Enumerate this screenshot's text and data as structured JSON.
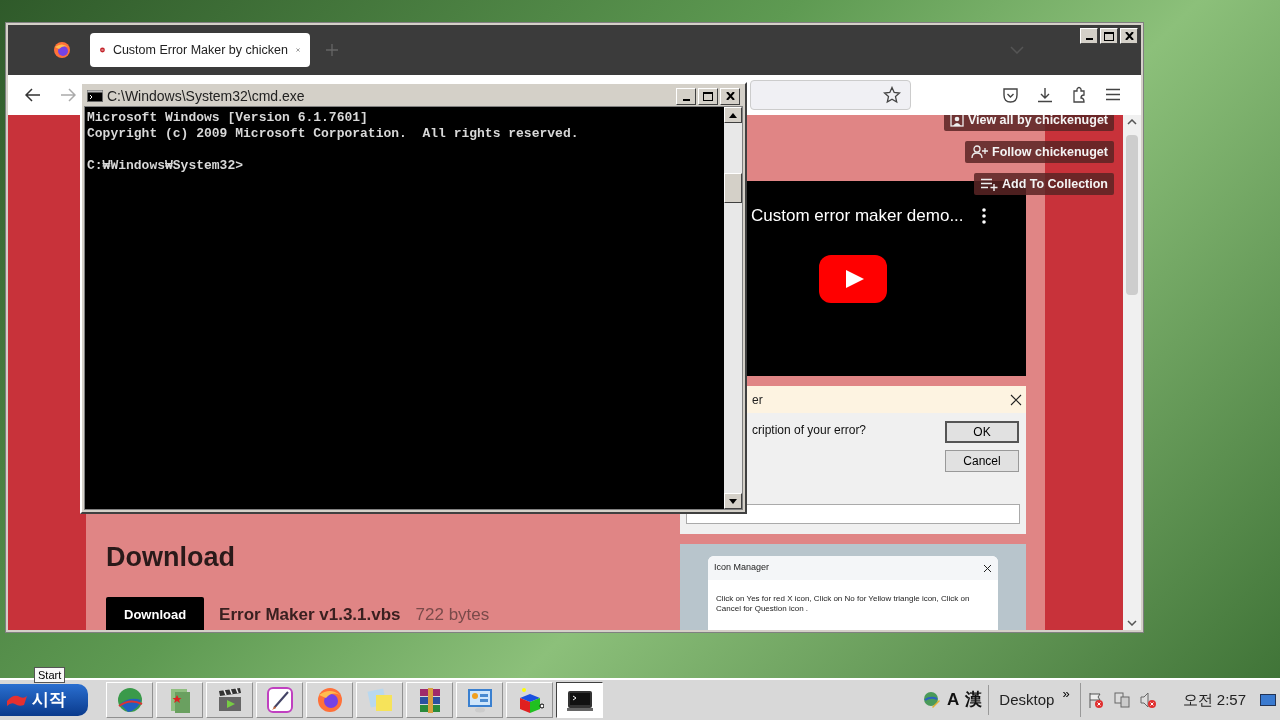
{
  "browser": {
    "tabs": [
      {
        "title": "Custom Error Maker by chicken",
        "selected": true
      }
    ],
    "page": {
      "actions": [
        {
          "kind": "view",
          "label": "View all by chickenuget"
        },
        {
          "kind": "follow",
          "label": "Follow chickenuget"
        },
        {
          "kind": "collection",
          "label": "Add To Collection"
        }
      ],
      "video_title": "Custom error maker demo...",
      "dialog": {
        "title": "er",
        "prompt": "cription of your error?",
        "buttons": [
          "OK",
          "Cancel"
        ]
      },
      "icon_manager": {
        "title": "Icon Manager",
        "message": "Click on Yes for red X icon, Click on No for Yellow triangle icon, Click on Cancel for Question icon ."
      },
      "download": {
        "heading": "Download",
        "button": "Download",
        "file": "Error Maker v1.3.1.vbs",
        "size": "722 bytes"
      }
    }
  },
  "cmd": {
    "title": "C:\\Windows\\System32\\cmd.exe",
    "output": [
      "Microsoft Windows [Version 6.1.7601]",
      "Copyright (c) 2009 Microsoft Corporation.  All rights reserved."
    ],
    "prompt": "C:₩Windows₩System32>"
  },
  "tooltip": "Start",
  "taskbar": {
    "start": "시작",
    "apps": [
      {
        "kind": "globe",
        "active": false
      },
      {
        "kind": "folder",
        "active": false
      },
      {
        "kind": "clapper",
        "active": false
      },
      {
        "kind": "paint",
        "active": false
      },
      {
        "kind": "firefox",
        "active": false
      },
      {
        "kind": "notes",
        "active": false
      },
      {
        "kind": "books",
        "active": false
      },
      {
        "kind": "panel",
        "active": false
      },
      {
        "kind": "cube",
        "active": false
      },
      {
        "kind": "terminal",
        "active": true
      }
    ],
    "language": [
      "A",
      "漢"
    ],
    "toolbar": "Desktop",
    "more": "»",
    "clock": "오전 2:57"
  }
}
